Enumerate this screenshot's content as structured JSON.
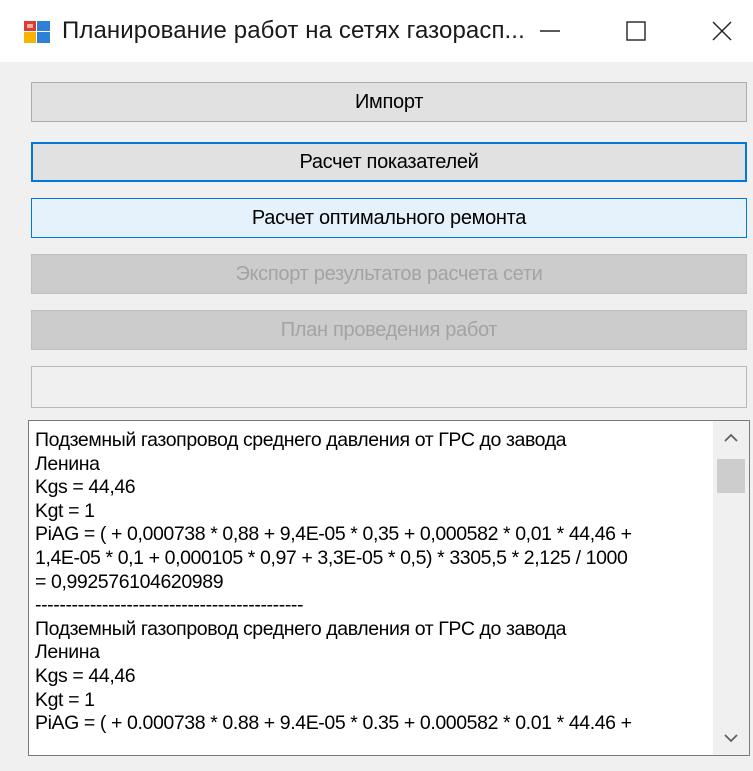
{
  "window": {
    "title": "Планирование работ на сетях газорасп...",
    "icon": "app-window-icon",
    "controls": [
      "minimize-icon",
      "maximize-icon",
      "close-icon"
    ]
  },
  "buttons": {
    "import": "Импорт",
    "calc_indicators": "Расчет показателей",
    "calc_repair": "Расчет оптимального ремонта",
    "export": "Экспорт результатов расчета сети",
    "plan": "План проведения работ"
  },
  "empty_field": {
    "value": ""
  },
  "output": {
    "lines": [
      "Подземный газопровод среднего давления от ГРС до завода",
      "Ленина",
      "Kgs = 44,46",
      "Kgt = 1",
      "PiAG = ( + 0,000738 * 0,88 + 9,4E-05 * 0,35 + 0,000582 * 0,01 * 44,46 +",
      "1,4E-05 * 0,1 + 0,000105 * 0,97 + 3,3E-05 * 0,5) * 3305,5 * 2,125 / 1000",
      "= 0,992576104620989",
      "--------------------------------------------",
      "Подземный газопровод среднего давления от ГРС до завода",
      "Ленина",
      "Kgs = 44,46",
      "Kgt = 1",
      "PiAG = ( + 0.000738 * 0.88 + 9.4E-05 * 0.35 + 0.000582 * 0.01 * 44.46 +"
    ]
  },
  "colors": {
    "focus_border": "#0078d7",
    "hover_bg": "#e5f1fb",
    "disabled_text": "#a3a3a3"
  }
}
